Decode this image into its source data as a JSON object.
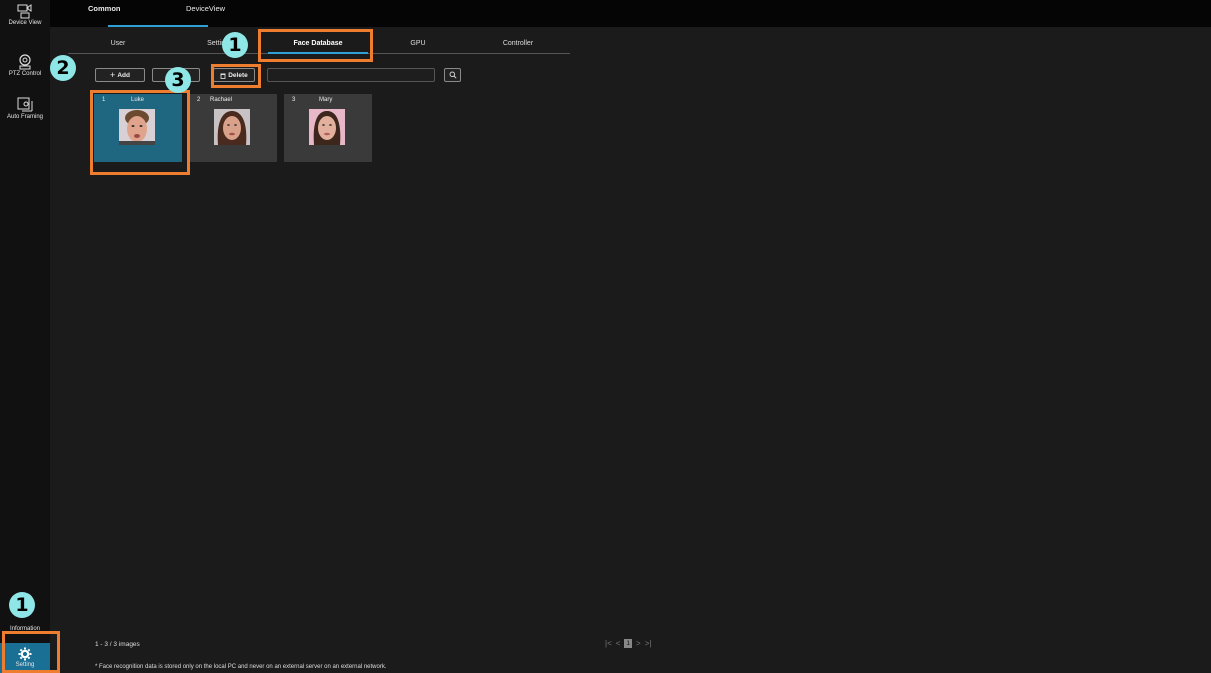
{
  "sidebar": {
    "device_view": "Device View",
    "ptz_control": "PTZ Control",
    "auto_framing": "Auto Framing",
    "information": "Information",
    "setting": "Setting"
  },
  "top_tabs": [
    "Common",
    "DeviceView"
  ],
  "sub_tabs": [
    "User",
    "Setting",
    "Face Database",
    "GPU",
    "Controller"
  ],
  "toolbar": {
    "add_label": "Add",
    "delete_label": "Delete",
    "search_value": ""
  },
  "faces": [
    {
      "index": "1",
      "name": "Luke",
      "selected": true
    },
    {
      "index": "2",
      "name": "Rachael",
      "selected": false
    },
    {
      "index": "3",
      "name": "Mary",
      "selected": false
    }
  ],
  "footer": {
    "count": "1 - 3 / 3 images",
    "current_page": "1",
    "note": "* Face recognition data is stored only on the local PC and never on an external server on an external network."
  },
  "annotations": [
    "1",
    "2",
    "3",
    "1"
  ],
  "colors": {
    "accent": "#2f9fd6",
    "highlight": "#ee7d2f",
    "badge": "#8fe6e7",
    "selected_card": "#1f6680"
  }
}
